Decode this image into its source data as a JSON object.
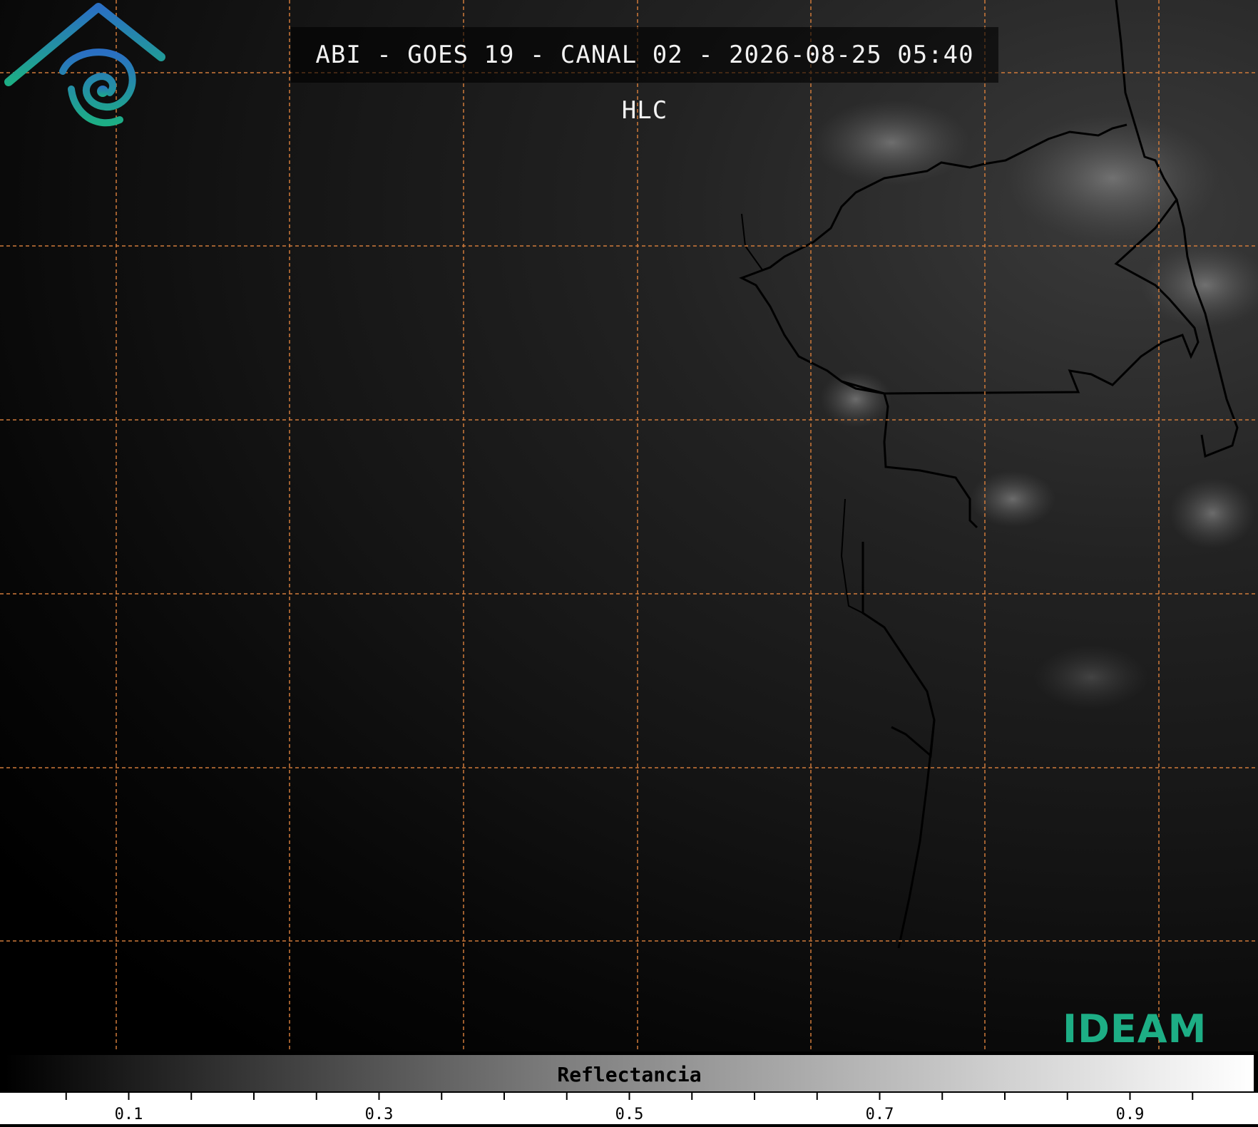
{
  "title": "ABI - GOES 19 - CANAL 02 - 2026-08-25 05:40 HLC",
  "logo": {
    "text": "IDEAM",
    "icon": "ideam-eye-roof-logo",
    "colors": [
      "#2a6fc4",
      "#1dae85"
    ]
  },
  "colorbar": {
    "label": "Reflectancia",
    "min": 0,
    "max": 1,
    "tick_labels": [
      "0.1",
      "0.3",
      "0.5",
      "0.7",
      "0.9"
    ],
    "tick_values": [
      0.1,
      0.3,
      0.5,
      0.7,
      0.9
    ],
    "minor_step": 0.05
  },
  "grid": {
    "color": "#d07a3a",
    "style": "dashed"
  }
}
